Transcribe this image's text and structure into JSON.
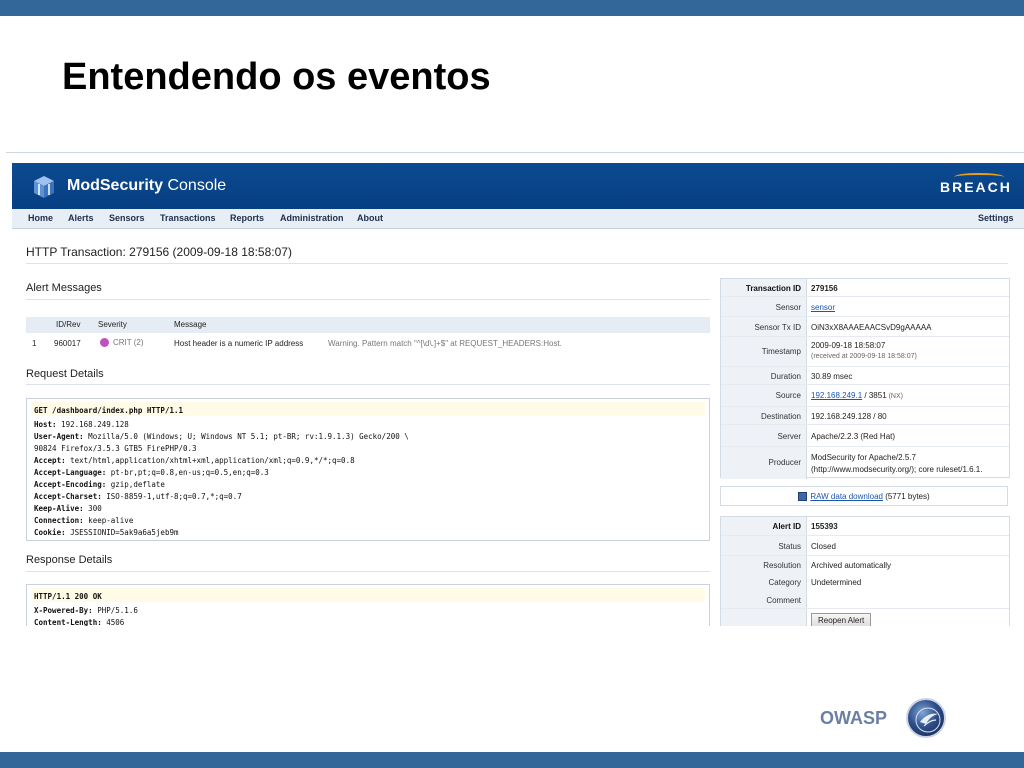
{
  "slide": {
    "title": "Entendendo os eventos",
    "footer_brand": "OWASP"
  },
  "console": {
    "brand_bold": "ModSecurity",
    "brand_rest": " Console",
    "vendor": "BREACH",
    "nav": [
      "Home",
      "Alerts",
      "Sensors",
      "Transactions",
      "Reports",
      "Administration",
      "About"
    ],
    "settings": "Settings",
    "page_title": "HTTP Transaction: 279156 (2009-09-18 18:58:07)"
  },
  "alerts": {
    "heading": "Alert Messages",
    "columns": [
      "ID/Rev",
      "Severity",
      "Message"
    ],
    "row": {
      "num": "1",
      "id": "960017",
      "severity": "CRIT (2)",
      "message": "Host header is a numeric IP address",
      "detail": "Warning. Pattern match \"^[\\d\\.]+$\" at REQUEST_HEADERS:Host."
    }
  },
  "request": {
    "heading": "Request Details",
    "first_line": "GET /dashboard/index.php HTTP/1.1",
    "headers": [
      {
        "k": "Host:",
        "v": " 192.168.249.128"
      },
      {
        "k": "User-Agent:",
        "v": " Mozilla/5.0 (Windows; U; Windows NT 5.1; pt-BR; rv:1.9.1.3) Gecko/200 \\"
      },
      {
        "k": "",
        "v": "90824 Firefox/3.5.3 GTB5 FirePHP/0.3"
      },
      {
        "k": "Accept:",
        "v": " text/html,application/xhtml+xml,application/xml;q=0.9,*/*;q=0.8"
      },
      {
        "k": "Accept-Language:",
        "v": " pt-br,pt;q=0.8,en-us;q=0.5,en;q=0.3"
      },
      {
        "k": "Accept-Encoding:",
        "v": " gzip,deflate"
      },
      {
        "k": "Accept-Charset:",
        "v": " ISO-8859-1,utf-8;q=0.7,*;q=0.7"
      },
      {
        "k": "Keep-Alive:",
        "v": " 300"
      },
      {
        "k": "Connection:",
        "v": " keep-alive"
      },
      {
        "k": "Cookie:",
        "v": " JSESSIONID=5ak9a6a5jeb9m"
      }
    ]
  },
  "response": {
    "heading": "Response Details",
    "first_line": "HTTP/1.1 200 OK",
    "headers": [
      {
        "k": "X-Powered-By:",
        "v": " PHP/5.1.6"
      },
      {
        "k": "Content-Length:",
        "v": " 4506"
      }
    ]
  },
  "transaction": {
    "id_label": "Transaction ID",
    "id": "279156",
    "sensor_label": "Sensor",
    "sensor": "sensor",
    "txid_label": "Sensor Tx ID",
    "txid": "OiN3xX8AAAEAACSvD9gAAAAA",
    "timestamp_label": "Timestamp",
    "timestamp": "2009-09-18 18:58:07",
    "received": "(received at 2009-09-18 18:58:07)",
    "duration_label": "Duration",
    "duration": "30.89 msec",
    "source_label": "Source",
    "source_ip": "192.168.249.1",
    "source_port": " / 3851",
    "source_nx": " (NX)",
    "dest_label": "Destination",
    "dest": "192.168.249.128 / 80",
    "server_label": "Server",
    "server": "Apache/2.2.3 (Red Hat)",
    "producer_label": "Producer",
    "producer_1": "ModSecurity for Apache/2.5.7",
    "producer_2": "(http://www.modsecurity.org/); core ruleset/1.6.1."
  },
  "raw": {
    "link": "RAW data download",
    "size": " (5771 bytes)"
  },
  "alert": {
    "id_label": "Alert ID",
    "id": "155393",
    "status_label": "Status",
    "status": "Closed",
    "resolution_label": "Resolution",
    "resolution": "Archived automatically",
    "category_label": "Category",
    "category": "Undetermined",
    "comment_label": "Comment",
    "reopen": "Reopen Alert"
  },
  "colors": {
    "slide_bar": "#336699",
    "console_header": "#0d4a91",
    "link": "#1a55b0"
  }
}
